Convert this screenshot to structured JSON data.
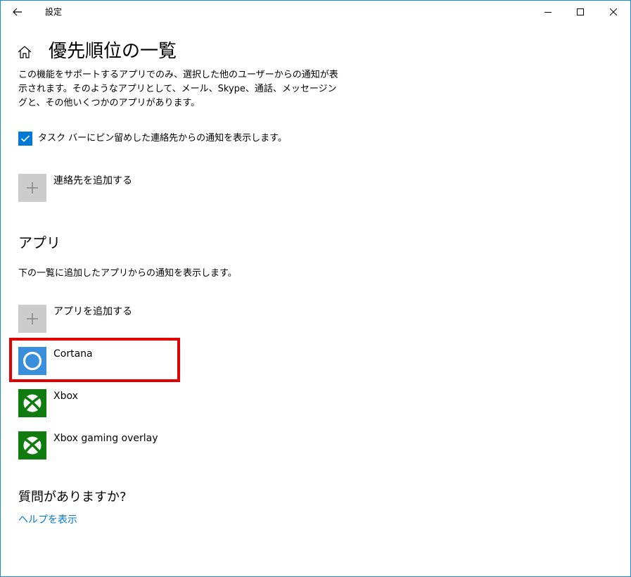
{
  "window": {
    "title": "設定"
  },
  "page": {
    "title": "優先順位の一覧",
    "description": "この機能をサポートするアプリでのみ、選択した他のユーザーからの通知が表示されます。そのようなアプリとして、メール、Skype、通話、メッセージングと、その他いくつかのアプリがあります。",
    "checkbox": {
      "label": "タスク バーにピン留めした連絡先からの通知を表示します。",
      "checked": true
    },
    "add_contact_label": "連絡先を追加する"
  },
  "apps_section": {
    "heading": "アプリ",
    "description": "下の一覧に追加したアプリからの通知を表示します。",
    "add_app_label": "アプリを追加する",
    "apps": [
      {
        "name": "Cortana",
        "icon": "cortana-icon",
        "highlighted": true
      },
      {
        "name": "Xbox",
        "icon": "xbox-icon",
        "highlighted": false
      },
      {
        "name": "Xbox gaming overlay",
        "icon": "xbox-icon",
        "highlighted": false
      }
    ]
  },
  "help": {
    "question": "質問がありますか?",
    "link": "ヘルプを表示"
  },
  "colors": {
    "accent": "#0078d7",
    "highlight_border": "#e00000",
    "xbox_green": "#107c10",
    "cortana_blue": "#3a8fdc",
    "add_tile_gray": "#cccccc",
    "window_border": "#1e88d2"
  }
}
